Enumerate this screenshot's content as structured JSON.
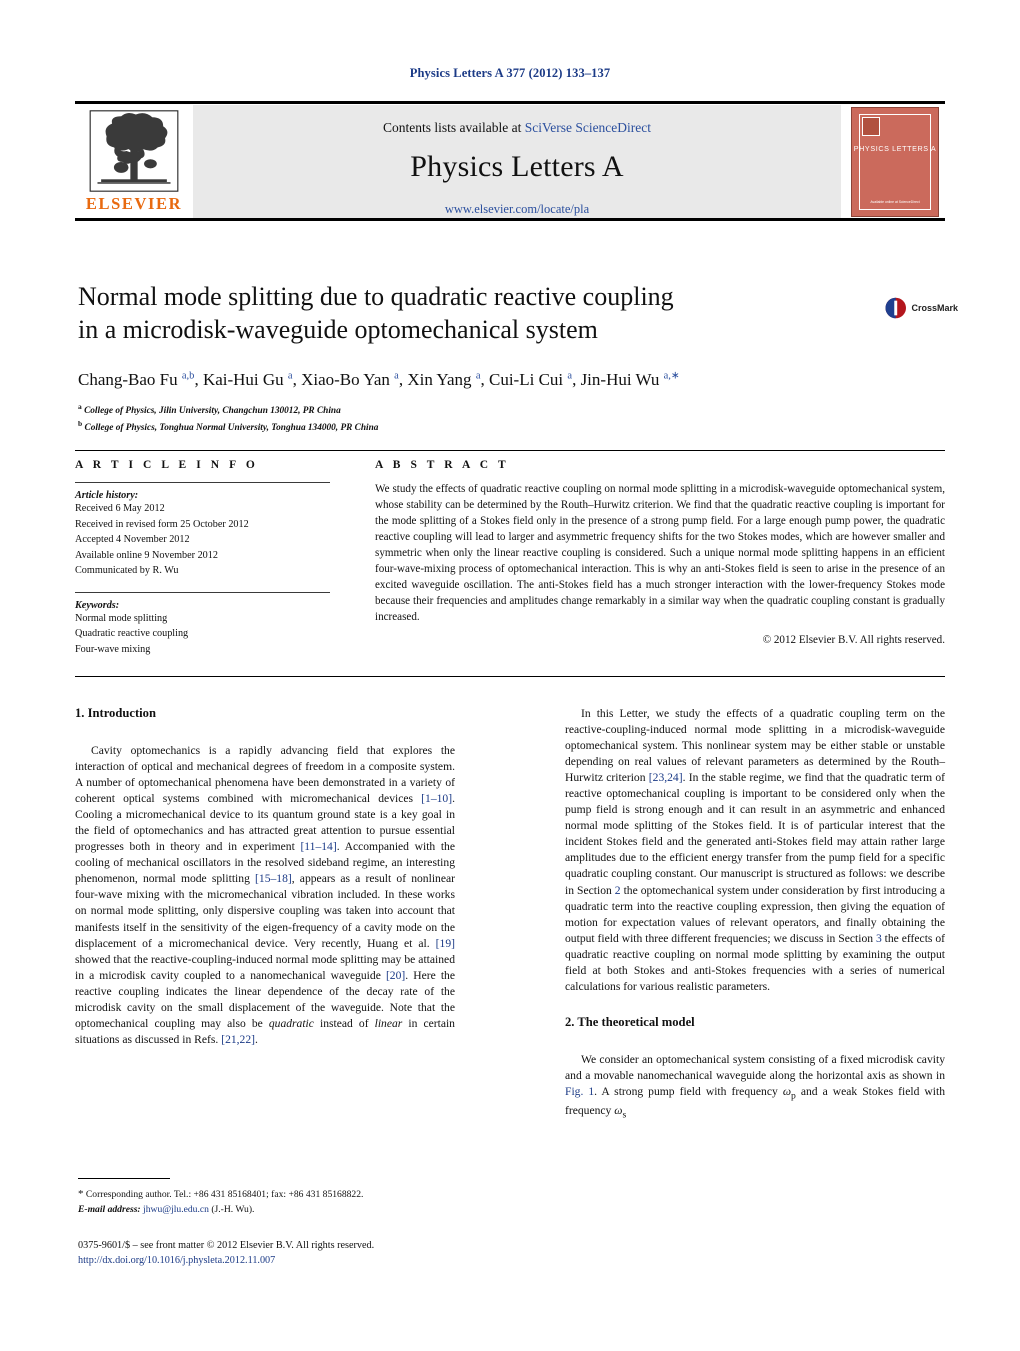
{
  "running_head": "Physics Letters A 377 (2012) 133–137",
  "header": {
    "contents_prefix": "Contents lists available at ",
    "contents_link": "SciVerse ScienceDirect",
    "journal_title": "Physics Letters A",
    "journal_url": "www.elsevier.com/locate/pla",
    "publisher_wordmark": "ELSEVIER",
    "cover": {
      "title": "PHYSICS LETTERS A",
      "footer": "Available online at\nScienceDirect"
    }
  },
  "article": {
    "title_line1": "Normal mode splitting due to quadratic reactive coupling",
    "title_line2": "in a microdisk-waveguide optomechanical system",
    "authors_html": "Chang-Bao Fu <sup>a,b</sup>, Kai-Hui Gu <sup>a</sup>, Xiao-Bo Yan <sup>a</sup>, Xin Yang <sup>a</sup>, Cui-Li Cui <sup>a</sup>, Jin-Hui Wu <sup>a,</sup><sup>∗</sup>",
    "affiliation_a": "College of Physics, Jilin University, Changchun 130012, PR China",
    "affiliation_b": "College of Physics, Tonghua Normal University, Tonghua 134000, PR China",
    "crossmark_label": "CrossMark"
  },
  "info": {
    "heading": "A R T I C L E   I N F O",
    "history_label": "Article history:",
    "history": [
      "Received 6 May 2012",
      "Received in revised form 25 October 2012",
      "Accepted 4 November 2012",
      "Available online 9 November 2012",
      "Communicated by R. Wu"
    ],
    "keywords_label": "Keywords:",
    "keywords": [
      "Normal mode splitting",
      "Quadratic reactive coupling",
      "Four-wave mixing"
    ]
  },
  "abstract": {
    "heading": "A B S T R A C T",
    "text": "We study the effects of quadratic reactive coupling on normal mode splitting in a microdisk-waveguide optomechanical system, whose stability can be determined by the Routh–Hurwitz criterion. We find that the quadratic reactive coupling is important for the mode splitting of a Stokes field only in the presence of a strong pump field. For a large enough pump power, the quadratic reactive coupling will lead to larger and asymmetric frequency shifts for the two Stokes modes, which are however smaller and symmetric when only the linear reactive coupling is considered. Such a unique normal mode splitting happens in an efficient four-wave-mixing process of optomechanical interaction. This is why an anti-Stokes field is seen to arise in the presence of an excited waveguide oscillation. The anti-Stokes field has a much stronger interaction with the lower-frequency Stokes mode because their frequencies and amplitudes change remarkably in a similar way when the quadratic coupling constant is gradually increased.",
    "copyright": "© 2012 Elsevier B.V. All rights reserved."
  },
  "body": {
    "section1_title": "1. Introduction",
    "section2_title": "2. The theoretical model",
    "para1_html": "Cavity optomechanics is a rapidly advancing field that explores the interaction of optical and mechanical degrees of freedom in a composite system. A number of optomechanical phenomena have been demonstrated in a variety of coherent optical systems combined with micromechanical devices <span class=\"ref\">[1–10]</span>. Cooling a micromechanical device to its quantum ground state is a key goal in the field of optomechanics and has attracted great attention to pursue essential progresses both in theory and in experiment <span class=\"ref\">[11–14]</span>. Accompanied with the cooling of mechanical oscillators in the resolved sideband regime, an interesting phenomenon, normal mode splitting <span class=\"ref\">[15–18]</span>, appears as a result of nonlinear four-wave mixing with the micromechanical vibration included. In these works on normal mode splitting, only dispersive coupling was taken into account that manifests itself in the sensitivity of the eigen-frequency of a cavity mode on the displacement of a micromechanical device. Very recently, Huang et al. <span class=\"ref\">[19]</span> showed that the reactive-coupling-induced normal mode splitting may be attained in a microdisk cavity coupled to a nanomechanical waveguide <span class=\"ref\">[20]</span>. Here the reactive coupling indicates the linear dependence of the decay rate of the microdisk cavity on the small displacement of the waveguide. Note that the optomechanical coupling may also be <span class=\"ital\">quadratic</span> instead of <span class=\"ital\">linear</span> in certain situations as discussed in Refs. <span class=\"ref\">[21,22]</span>.",
    "para2_html": "In this Letter, we study the effects of a quadratic coupling term on the reactive-coupling-induced normal mode splitting in a microdisk-waveguide optomechanical system. This nonlinear system may be either stable or unstable depending on real values of relevant parameters as determined by the Routh–Hurwitz criterion <span class=\"ref\">[23,24]</span>. In the stable regime, we find that the quadratic term of reactive optomechanical coupling is important to be considered only when the pump field is strong enough and it can result in an asymmetric and enhanced normal mode splitting of the Stokes field. It is of particular interest that the incident Stokes field and the generated anti-Stokes field may attain rather large amplitudes due to the efficient energy transfer from the pump field for a specific quadratic coupling constant. Our manuscript is structured as follows: we describe in Section <span class=\"ref\">2</span> the optomechanical system under consideration by first introducing a quadratic term into the reactive coupling expression, then giving the equation of motion for expectation values of relevant operators, and finally obtaining the output field with three different frequencies; we discuss in Section <span class=\"ref\">3</span> the effects of quadratic reactive coupling on normal mode splitting by examining the output field at both Stokes and anti-Stokes frequencies with a series of numerical calculations for various realistic parameters.",
    "para3_html": "We consider an optomechanical system consisting of a fixed microdisk cavity and a movable nanomechanical waveguide along the horizontal axis as shown in <span class=\"ref\">Fig. 1</span>. A strong pump field with frequency <span class=\"ital\">ω</span><sub>p</sub> and a weak Stokes field with frequency <span class=\"ital\">ω</span><sub>s</sub>"
  },
  "footnote": {
    "marker": "*",
    "corresponding": "Corresponding author. Tel.: +86 431 85168401; fax: +86 431 85168822.",
    "email_label": "E-mail address:",
    "email": "jhwu@jlu.edu.cn",
    "email_suffix": "(J.-H. Wu).",
    "issn_line": "0375-9601/$ – see front matter  © 2012 Elsevier B.V. All rights reserved.",
    "doi": "http://dx.doi.org/10.1016/j.physleta.2012.11.007"
  },
  "colors": {
    "link_blue": "#1b3a86",
    "elsevier_orange": "#E86A10",
    "cover_red": "#cb6a5c",
    "band_gray": "#e9e9e9"
  }
}
